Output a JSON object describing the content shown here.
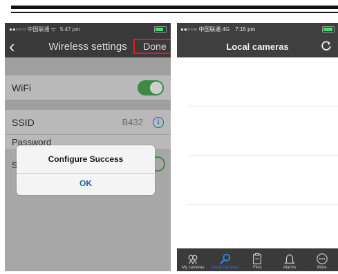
{
  "left": {
    "status": {
      "carrier": "●●○○○ 中国联通 ᯤ",
      "time": "5:47 pm"
    },
    "nav": {
      "back": "‹",
      "title": "Wireless settings",
      "done": "Done"
    },
    "rows": {
      "wifi_label": "WiFi",
      "ssid_label": "SSID",
      "ssid_value": "B432",
      "password_label": "Password",
      "s_label": "S"
    },
    "dialog": {
      "title": "Configure Success",
      "ok": "OK"
    }
  },
  "right": {
    "status": {
      "carrier": "●●○○○ 中国联通 4G",
      "time": "7:15 pm"
    },
    "nav": {
      "title": "Local cameras"
    },
    "tabs": [
      {
        "label": "My cameras",
        "icon": "cameras-icon"
      },
      {
        "label": "Local cameras",
        "icon": "search-icon",
        "active": true
      },
      {
        "label": "Files",
        "icon": "clipboard-icon"
      },
      {
        "label": "Alarms",
        "icon": "bell-icon"
      },
      {
        "label": "More",
        "icon": "more-icon"
      }
    ]
  },
  "colors": {
    "accent_blue": "#2f7dd8",
    "toggle_green": "#3c8a45",
    "highlight_red": "#e31b23"
  }
}
